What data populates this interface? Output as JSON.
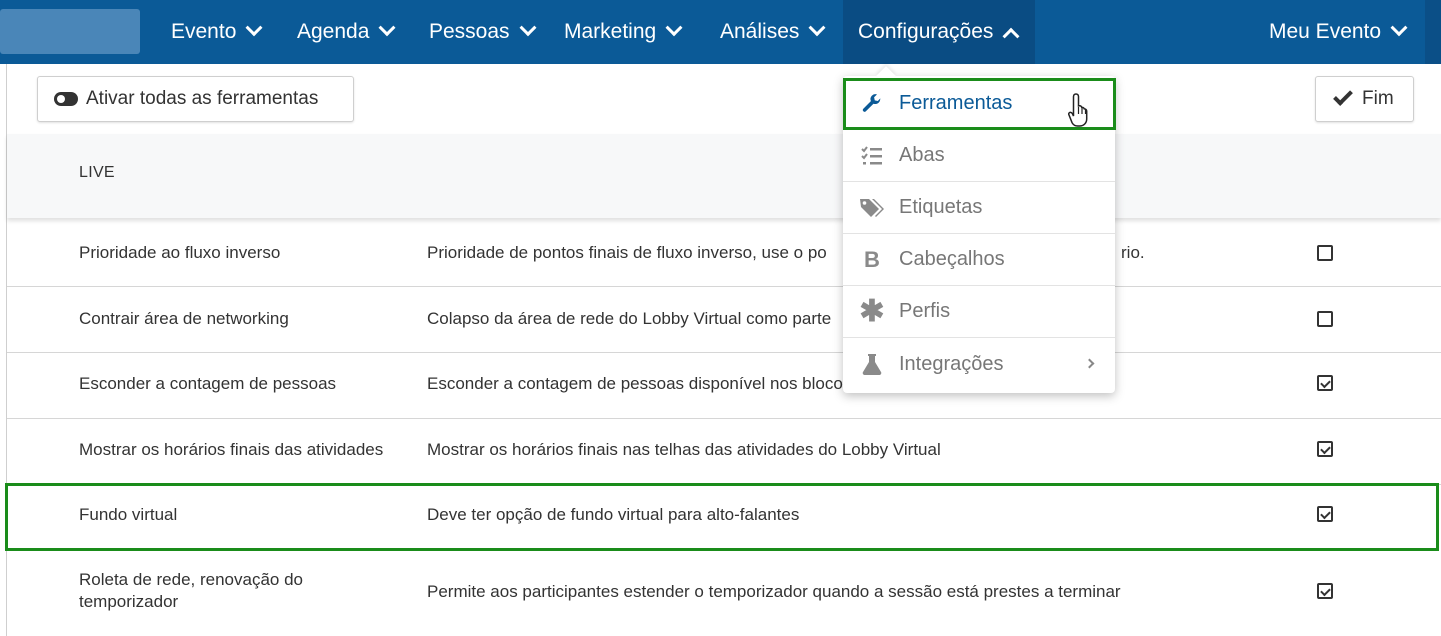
{
  "nav": {
    "items": [
      {
        "label": "Evento"
      },
      {
        "label": "Agenda"
      },
      {
        "label": "Pessoas"
      },
      {
        "label": "Marketing"
      },
      {
        "label": "Análises"
      },
      {
        "label": "Configurações"
      },
      {
        "label": "Meu Evento"
      }
    ]
  },
  "toolbar": {
    "activate_all_label": "Ativar todas as ferramentas",
    "done_label": "Fim"
  },
  "section": {
    "title": "LIVE"
  },
  "rows": [
    {
      "name": "Prioridade ao fluxo inverso",
      "desc": "Prioridade de pontos finais de fluxo inverso, use o po",
      "desc_tail": "rio.",
      "checked": false
    },
    {
      "name": "Contrair área de networking",
      "desc": "Colapso da área de rede do Lobby Virtual como parte",
      "checked": false
    },
    {
      "name": "Esconder a contagem de pessoas",
      "desc": "Esconder a contagem de pessoas disponível nos bloco",
      "checked": true
    },
    {
      "name": "Mostrar os horários finais das atividades",
      "desc": "Mostrar os horários finais nas telhas das atividades do Lobby Virtual",
      "checked": true
    },
    {
      "name": "Fundo virtual",
      "desc": "Deve ter opção de fundo virtual para alto-falantes",
      "checked": true
    },
    {
      "name": "Roleta de rede, renovação do temporizador",
      "desc": "Permite aos participantes estender o temporizador quando a sessão está prestes a terminar",
      "checked": true
    }
  ],
  "dropdown": {
    "items": [
      {
        "label": "Ferramentas",
        "icon": "wrench-icon"
      },
      {
        "label": "Abas",
        "icon": "list-check-icon"
      },
      {
        "label": "Etiquetas",
        "icon": "tags-icon"
      },
      {
        "label": "Cabeçalhos",
        "icon": "bold-icon"
      },
      {
        "label": "Perfis",
        "icon": "asterisk-icon"
      },
      {
        "label": "Integrações",
        "icon": "flask-icon"
      }
    ]
  },
  "colors": {
    "nav_bg": "#0b5a97",
    "highlight": "#1a8c1a"
  }
}
